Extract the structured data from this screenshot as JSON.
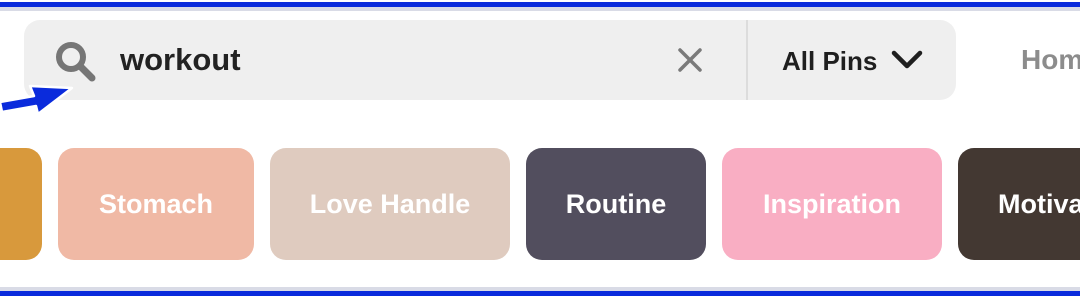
{
  "search": {
    "query": "workout",
    "filter_label": "All Pins",
    "icon": "search-icon",
    "clear_icon": "close-icon",
    "filter_icon": "chevron-down-icon"
  },
  "nav": {
    "home_label": "Hom"
  },
  "annotation": {
    "icon": "arrow-icon",
    "color": "#0a2bdc"
  },
  "frame": {
    "color": "#0a2bdc"
  },
  "chips": [
    {
      "label": "",
      "color": "#d8993c"
    },
    {
      "label": "Stomach",
      "color": "#f0b9a5"
    },
    {
      "label": "Love Handle",
      "color": "#dfcbbf"
    },
    {
      "label": "Routine",
      "color": "#524e5e"
    },
    {
      "label": "Inspiration",
      "color": "#f9aec3"
    },
    {
      "label": "Motiva",
      "color": "#433832"
    }
  ]
}
